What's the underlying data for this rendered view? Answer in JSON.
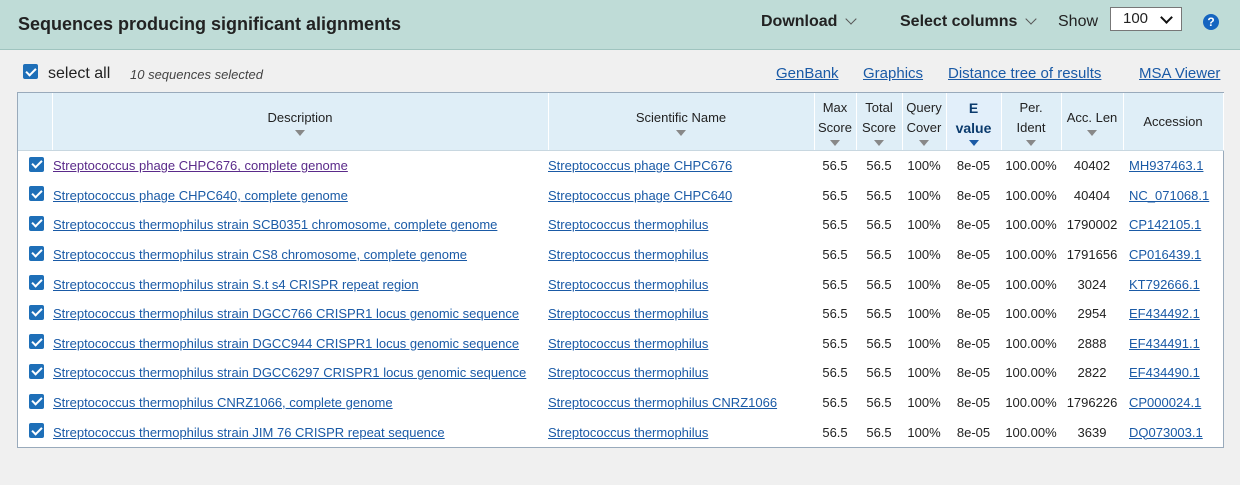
{
  "header": {
    "title": "Sequences producing significant alignments",
    "download_label": "Download",
    "select_columns_label": "Select columns",
    "show_label": "Show",
    "show_value": "100",
    "help_symbol": "?"
  },
  "toolbar": {
    "select_all_label": "select all",
    "selected_count": "10 sequences selected",
    "links": [
      "GenBank",
      "Graphics",
      "Distance tree of results",
      "MSA Viewer"
    ]
  },
  "table": {
    "columns": {
      "description": "Description",
      "scientific_name": "Scientific Name",
      "max_score_1": "Max",
      "max_score_2": "Score",
      "total_score_1": "Total",
      "total_score_2": "Score",
      "query_cover_1": "Query",
      "query_cover_2": "Cover",
      "e_value_1": "E",
      "e_value_2": "value",
      "per_ident_1": "Per.",
      "per_ident_2": "Ident",
      "acc_len": "Acc. Len",
      "accession": "Accession"
    },
    "rows": [
      {
        "description": "Streptococcus phage CHPC676, complete genome",
        "scientific_name": "Streptococcus phage CHPC676",
        "max_score": "56.5",
        "total_score": "56.5",
        "query_cover": "100%",
        "e_value": "8e-05",
        "per_ident": "100.00%",
        "acc_len": "40402",
        "accession": "MH937463.1"
      },
      {
        "description": "Streptococcus phage CHPC640, complete genome",
        "scientific_name": "Streptococcus phage CHPC640",
        "max_score": "56.5",
        "total_score": "56.5",
        "query_cover": "100%",
        "e_value": "8e-05",
        "per_ident": "100.00%",
        "acc_len": "40404",
        "accession": "NC_071068.1"
      },
      {
        "description": "Streptococcus thermophilus strain SCB0351 chromosome, complete genome",
        "scientific_name": "Streptococcus thermophilus",
        "max_score": "56.5",
        "total_score": "56.5",
        "query_cover": "100%",
        "e_value": "8e-05",
        "per_ident": "100.00%",
        "acc_len": "1790002",
        "accession": "CP142105.1"
      },
      {
        "description": "Streptococcus thermophilus strain CS8 chromosome, complete genome",
        "scientific_name": "Streptococcus thermophilus",
        "max_score": "56.5",
        "total_score": "56.5",
        "query_cover": "100%",
        "e_value": "8e-05",
        "per_ident": "100.00%",
        "acc_len": "1791656",
        "accession": "CP016439.1"
      },
      {
        "description": "Streptococcus thermophilus strain S.t s4 CRISPR repeat region",
        "scientific_name": "Streptococcus thermophilus",
        "max_score": "56.5",
        "total_score": "56.5",
        "query_cover": "100%",
        "e_value": "8e-05",
        "per_ident": "100.00%",
        "acc_len": "3024",
        "accession": "KT792666.1"
      },
      {
        "description": "Streptococcus thermophilus strain DGCC766 CRISPR1 locus genomic sequence",
        "scientific_name": "Streptococcus thermophilus",
        "max_score": "56.5",
        "total_score": "56.5",
        "query_cover": "100%",
        "e_value": "8e-05",
        "per_ident": "100.00%",
        "acc_len": "2954",
        "accession": "EF434492.1"
      },
      {
        "description": "Streptococcus thermophilus strain DGCC944 CRISPR1 locus genomic sequence",
        "scientific_name": "Streptococcus thermophilus",
        "max_score": "56.5",
        "total_score": "56.5",
        "query_cover": "100%",
        "e_value": "8e-05",
        "per_ident": "100.00%",
        "acc_len": "2888",
        "accession": "EF434491.1"
      },
      {
        "description": "Streptococcus thermophilus strain DGCC6297 CRISPR1 locus genomic sequence",
        "scientific_name": "Streptococcus thermophilus",
        "max_score": "56.5",
        "total_score": "56.5",
        "query_cover": "100%",
        "e_value": "8e-05",
        "per_ident": "100.00%",
        "acc_len": "2822",
        "accession": "EF434490.1"
      },
      {
        "description": "Streptococcus thermophilus CNRZ1066, complete genome",
        "scientific_name": "Streptococcus thermophilus CNRZ1066",
        "max_score": "56.5",
        "total_score": "56.5",
        "query_cover": "100%",
        "e_value": "8e-05",
        "per_ident": "100.00%",
        "acc_len": "1796226",
        "accession": "CP000024.1"
      },
      {
        "description": "Streptococcus thermophilus strain JIM 76 CRISPR repeat sequence",
        "scientific_name": "Streptococcus thermophilus",
        "max_score": "56.5",
        "total_score": "56.5",
        "query_cover": "100%",
        "e_value": "8e-05",
        "per_ident": "100.00%",
        "acc_len": "3639",
        "accession": "DQ073003.1"
      }
    ]
  },
  "colors": {
    "header_bg": "#bfdcd7",
    "link": "#1a5aa6",
    "checkbox": "#1e6fb8",
    "table_header_bg": "#dfeef7"
  }
}
